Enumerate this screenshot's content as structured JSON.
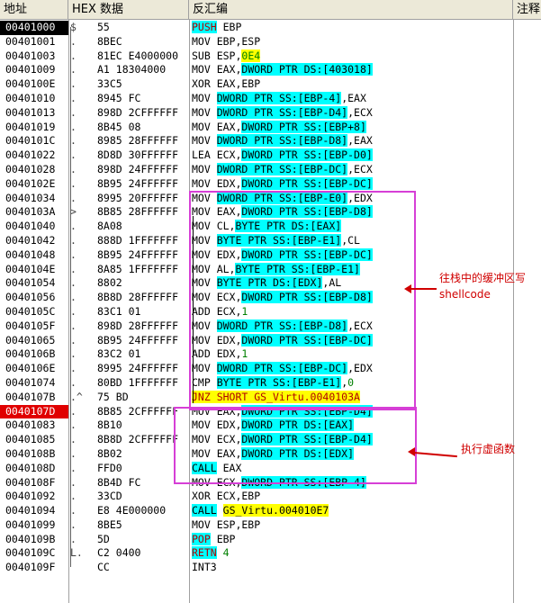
{
  "header": {
    "addr": "地址",
    "hex": "HEX 数据",
    "dis": "反汇编",
    "comment": "注释"
  },
  "rows": [
    {
      "addr": "00401000",
      "mark": "$",
      "hex": "55",
      "dis": "PUSH EBP"
    },
    {
      "addr": "00401001",
      "mark": ".",
      "hex": "8BEC",
      "dis": "MOV EBP,ESP"
    },
    {
      "addr": "00401003",
      "mark": ".",
      "hex": "81EC E4000000",
      "dis": "SUB ESP,0E4"
    },
    {
      "addr": "00401009",
      "mark": ".",
      "hex": "A1 18304000",
      "dis": "MOV EAX,DWORD PTR DS:[403018]"
    },
    {
      "addr": "0040100E",
      "mark": ".",
      "hex": "33C5",
      "dis": "XOR EAX,EBP"
    },
    {
      "addr": "00401010",
      "mark": ".",
      "hex": "8945 FC",
      "dis": "MOV DWORD PTR SS:[EBP-4],EAX"
    },
    {
      "addr": "00401013",
      "mark": ".",
      "hex": "898D 2CFFFFFF",
      "dis": "MOV DWORD PTR SS:[EBP-D4],ECX"
    },
    {
      "addr": "00401019",
      "mark": ".",
      "hex": "8B45 08",
      "dis": "MOV EAX,DWORD PTR SS:[EBP+8]"
    },
    {
      "addr": "0040101C",
      "mark": ".",
      "hex": "8985 28FFFFFF",
      "dis": "MOV DWORD PTR SS:[EBP-D8],EAX"
    },
    {
      "addr": "00401022",
      "mark": ".",
      "hex": "8D8D 30FFFFFF",
      "dis": "LEA ECX,DWORD PTR SS:[EBP-D0]"
    },
    {
      "addr": "00401028",
      "mark": ".",
      "hex": "898D 24FFFFFF",
      "dis": "MOV DWORD PTR SS:[EBP-DC],ECX"
    },
    {
      "addr": "0040102E",
      "mark": ".",
      "hex": "8B95 24FFFFFF",
      "dis": "MOV EDX,DWORD PTR SS:[EBP-DC]"
    },
    {
      "addr": "00401034",
      "mark": ".",
      "hex": "8995 20FFFFFF",
      "dis": "MOV DWORD PTR SS:[EBP-E0],EDX"
    },
    {
      "addr": "0040103A",
      "mark": ">",
      "hex": "8B85 28FFFFFF",
      "dis": "MOV EAX,DWORD PTR SS:[EBP-D8]"
    },
    {
      "addr": "00401040",
      "mark": ".",
      "hex": "8A08",
      "dis": "MOV CL,BYTE PTR DS:[EAX]"
    },
    {
      "addr": "00401042",
      "mark": ".",
      "hex": "888D 1FFFFFFF",
      "dis": "MOV BYTE PTR SS:[EBP-E1],CL"
    },
    {
      "addr": "00401048",
      "mark": ".",
      "hex": "8B95 24FFFFFF",
      "dis": "MOV EDX,DWORD PTR SS:[EBP-DC]"
    },
    {
      "addr": "0040104E",
      "mark": ".",
      "hex": "8A85 1FFFFFFF",
      "dis": "MOV AL,BYTE PTR SS:[EBP-E1]"
    },
    {
      "addr": "00401054",
      "mark": ".",
      "hex": "8802",
      "dis": "MOV BYTE PTR DS:[EDX],AL"
    },
    {
      "addr": "00401056",
      "mark": ".",
      "hex": "8B8D 28FFFFFF",
      "dis": "MOV ECX,DWORD PTR SS:[EBP-D8]"
    },
    {
      "addr": "0040105C",
      "mark": ".",
      "hex": "83C1 01",
      "dis": "ADD ECX,1"
    },
    {
      "addr": "0040105F",
      "mark": ".",
      "hex": "898D 28FFFFFF",
      "dis": "MOV DWORD PTR SS:[EBP-D8],ECX"
    },
    {
      "addr": "00401065",
      "mark": ".",
      "hex": "8B95 24FFFFFF",
      "dis": "MOV EDX,DWORD PTR SS:[EBP-DC]"
    },
    {
      "addr": "0040106B",
      "mark": ".",
      "hex": "83C2 01",
      "dis": "ADD EDX,1"
    },
    {
      "addr": "0040106E",
      "mark": ".",
      "hex": "8995 24FFFFFF",
      "dis": "MOV DWORD PTR SS:[EBP-DC],EDX"
    },
    {
      "addr": "00401074",
      "mark": ".",
      "hex": "80BD 1FFFFFFF",
      "dis": "CMP BYTE PTR SS:[EBP-E1],0"
    },
    {
      "addr": "0040107B",
      "mark": ".^",
      "hex": "75 BD",
      "dis": "JNZ SHORT GS_Virtu.0040103A"
    },
    {
      "addr": "0040107D",
      "mark": ".",
      "hex": "8B85 2CFFFFFF",
      "dis": "MOV EAX,DWORD PTR SS:[EBP-D4]"
    },
    {
      "addr": "00401083",
      "mark": ".",
      "hex": "8B10",
      "dis": "MOV EDX,DWORD PTR DS:[EAX]"
    },
    {
      "addr": "00401085",
      "mark": ".",
      "hex": "8B8D 2CFFFFFF",
      "dis": "MOV ECX,DWORD PTR SS:[EBP-D4]"
    },
    {
      "addr": "0040108B",
      "mark": ".",
      "hex": "8B02",
      "dis": "MOV EAX,DWORD PTR DS:[EDX]"
    },
    {
      "addr": "0040108D",
      "mark": ".",
      "hex": "FFD0",
      "dis": "CALL EAX"
    },
    {
      "addr": "0040108F",
      "mark": ".",
      "hex": "8B4D FC",
      "dis": "MOV ECX,DWORD PTR SS:[EBP-4]"
    },
    {
      "addr": "00401092",
      "mark": ".",
      "hex": "33CD",
      "dis": "XOR ECX,EBP"
    },
    {
      "addr": "00401094",
      "mark": ".",
      "hex": "E8 4E000000",
      "dis": "CALL GS_Virtu.004010E7"
    },
    {
      "addr": "00401099",
      "mark": ".",
      "hex": "8BE5",
      "dis": "MOV ESP,EBP"
    },
    {
      "addr": "0040109B",
      "mark": ".",
      "hex": "5D",
      "dis": "POP EBP"
    },
    {
      "addr": "0040109C",
      "mark": "L.",
      "hex": "C2 0400",
      "dis": "RETN 4"
    },
    {
      "addr": "0040109F",
      "mark": "",
      "hex": "CC",
      "dis": "INT3"
    }
  ],
  "annotations": {
    "shellcode": "往栈中的缓冲区写shellcode",
    "virtual": "执行虚函数"
  },
  "colors": {
    "highlight": "#00ffff",
    "call_bg": "#00ffff",
    "jump_bg": "#ffff00",
    "box": "#d63fd6",
    "annotation": "#d00000",
    "breakpoint": "#e00000"
  }
}
